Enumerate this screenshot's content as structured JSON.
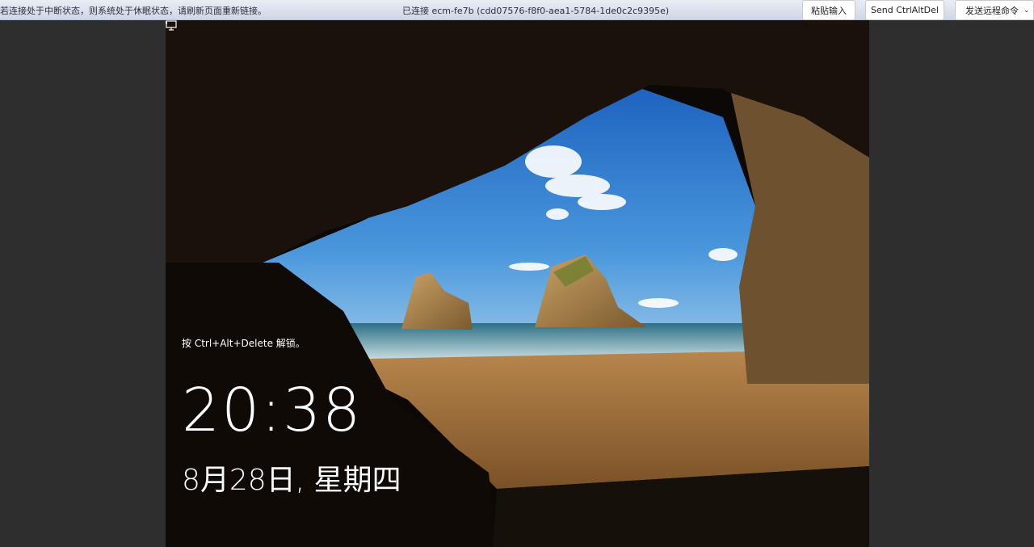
{
  "topbar": {
    "hint_text": "若连接处于中断状态，则系统处于休眠状态，请刷新页面重新链接。",
    "connection_text": "已连接 ecm-fe7b (cdd07576-f8f0-aea1-5784-1de0c2c9395e)",
    "paste_label": "粘贴输入",
    "send_cad_label": "Send CtrlAltDel",
    "remote_cmd_label": "发送远程命令"
  },
  "lockscreen": {
    "unlock_prompt": "按 Ctrl+Alt+Delete 解锁。",
    "time": "20:38",
    "date": "8月28日, 星期四"
  },
  "icons": {
    "dropdown": "chevron-down-icon",
    "network": "network-icon"
  },
  "colors": {
    "topbar_bg": "#dde3ef",
    "side_bg": "#2e2e2e",
    "sky": "#2f7fd0",
    "sand": "#a7743e"
  }
}
